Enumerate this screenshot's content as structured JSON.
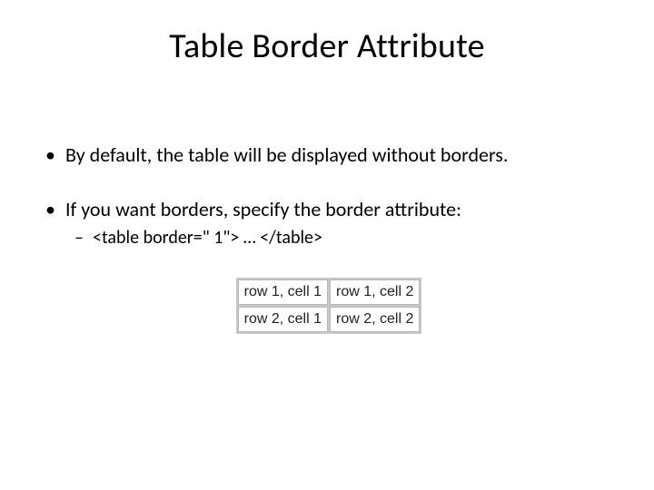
{
  "title": "Table Border Attribute",
  "bullets": {
    "b1": "By default, the table will be displayed without borders.",
    "b2": "If you want borders, specify the border attribute:",
    "b2_sub1": "<table border=\" 1\"> … </table>"
  },
  "table": {
    "r1c1": "row 1, cell 1",
    "r1c2": "row 1, cell 2",
    "r2c1": "row 2, cell 1",
    "r2c2": "row 2, cell 2"
  }
}
